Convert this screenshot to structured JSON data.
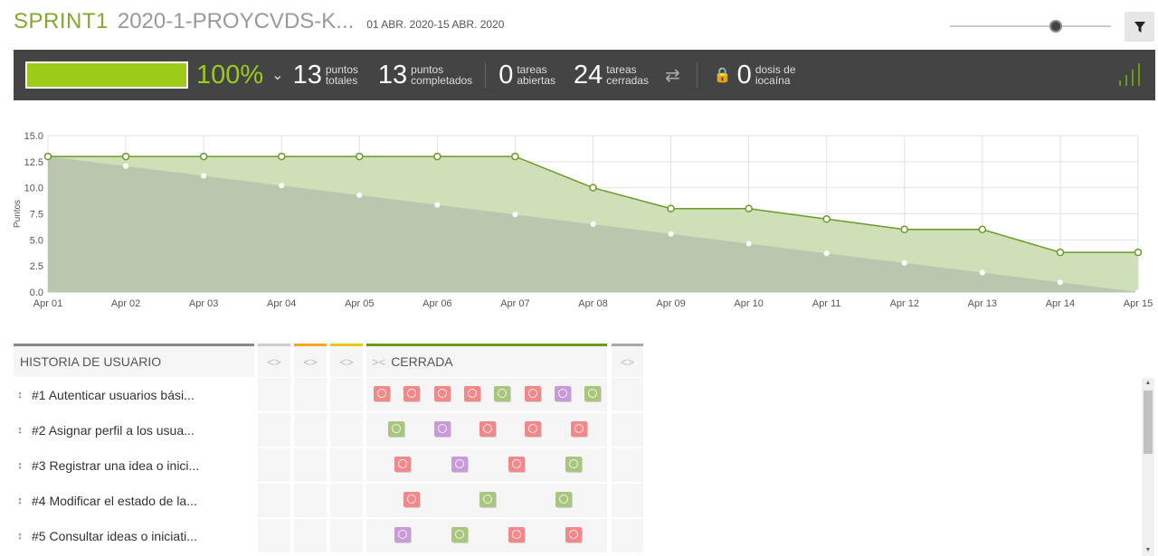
{
  "header": {
    "sprint_name": "SPRINT1",
    "project_name": "2020-1-PROYCVDS-K...",
    "dates": "01 ABR. 2020-15 ABR. 2020"
  },
  "stats": {
    "progress_pct": "100%",
    "progress_fraction": 1.0,
    "total_points": "13",
    "total_points_label_1": "puntos",
    "total_points_label_2": "totales",
    "completed_points": "13",
    "completed_label_1": "puntos",
    "completed_label_2": "completados",
    "open_tasks": "0",
    "open_label_1": "tareas",
    "open_label_2": "abiertas",
    "closed_tasks": "24",
    "closed_label_1": "tareas",
    "closed_label_2": "cerradas",
    "iocaine": "0",
    "iocaine_label_1": "dosis de",
    "iocaine_label_2": "iocaína"
  },
  "colors": {
    "accent_green": "#83a92c",
    "progress_green": "#9ccb19",
    "card_red": "#f2888a",
    "card_green": "#a8c67d",
    "card_purple": "#c99ad8"
  },
  "chart_data": {
    "type": "area",
    "title": "",
    "xlabel": "",
    "ylabel": "Puntos",
    "x": [
      "Apr 01",
      "Apr 02",
      "Apr 03",
      "Apr 04",
      "Apr 05",
      "Apr 06",
      "Apr 07",
      "Apr 08",
      "Apr 09",
      "Apr 10",
      "Apr 11",
      "Apr 12",
      "Apr 13",
      "Apr 14",
      "Apr 15"
    ],
    "ylim": [
      0,
      15
    ],
    "yticks": [
      "0.0",
      "2.5",
      "5.0",
      "7.5",
      "10.0",
      "12.5",
      "15.0"
    ],
    "grid": true,
    "series": [
      {
        "values": [
          13,
          13,
          13,
          13,
          13,
          13,
          13,
          10,
          8,
          8,
          7,
          6,
          6,
          3.8,
          3.8
        ]
      },
      {
        "values": [
          13,
          12.07,
          11.14,
          10.21,
          9.29,
          8.36,
          7.43,
          6.5,
          5.57,
          4.64,
          3.71,
          2.79,
          1.86,
          0.93,
          0
        ]
      }
    ]
  },
  "taskboard": {
    "story_header": "HISTORIA DE USUARIO",
    "col_arrows_open": "<>",
    "col_arrows_closed": "><",
    "closed_header": "CERRADA",
    "stories": [
      {
        "label": "#1 Autenticar usuarios bási...",
        "cards": [
          "red",
          "red",
          "red",
          "red",
          "green",
          "red",
          "purple",
          "green"
        ]
      },
      {
        "label": "#2 Asignar perfil a los usua...",
        "cards": [
          "green",
          "purple",
          "red",
          "red",
          "red"
        ]
      },
      {
        "label": "#3 Registrar una idea o inici...",
        "cards": [
          "red",
          "purple",
          "red",
          "green"
        ]
      },
      {
        "label": "#4 Modificar el estado de la...",
        "cards": [
          "red",
          "green",
          "green"
        ]
      },
      {
        "label": "#5 Consultar ideas o iniciati...",
        "cards": [
          "purple",
          "green",
          "red",
          "red"
        ]
      }
    ]
  }
}
